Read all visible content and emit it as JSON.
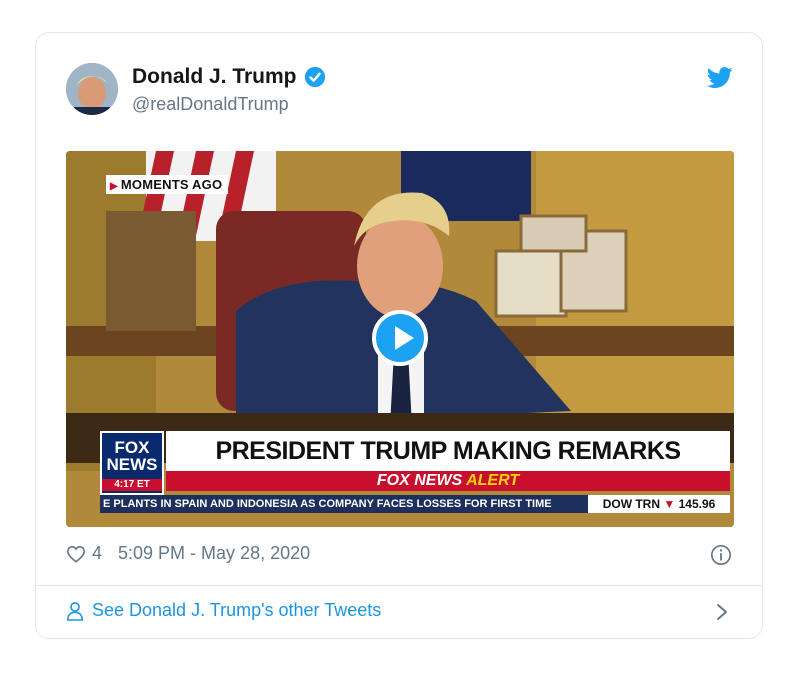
{
  "tweet": {
    "author_name": "Donald J. Trump",
    "handle": "@realDonaldTrump",
    "likes": "4",
    "timestamp": "5:09 PM - May 28, 2020",
    "footer_link": "See Donald J. Trump's other Tweets"
  },
  "video": {
    "badge": "MOMENTS AGO",
    "channel_logo_line1": "FOX",
    "channel_logo_line2": "NEWS",
    "channel_time": "4:17 ET",
    "headline": "PRESIDENT TRUMP MAKING REMARKS",
    "alert_prefix": "FOX NEWS",
    "alert_word": "ALERT",
    "ticker": "E PLANTS IN SPAIN AND INDONESIA AS COMPANY FACES LOSSES FOR FIRST TIME",
    "stock_label": "DOW TRN",
    "stock_arrow": "▼",
    "stock_value": "145.96"
  },
  "colors": {
    "accent": "#1da1f2",
    "link": "#1b95e0",
    "muted": "#657786",
    "fox_red": "#c8102e",
    "fox_blue": "#0a2a6e"
  },
  "icons": {
    "verified": "verified-badge-icon",
    "brand": "twitter-bird-icon",
    "like": "heart-icon",
    "info": "info-icon",
    "person": "person-icon",
    "chevron": "chevron-right-icon",
    "play": "play-icon"
  }
}
